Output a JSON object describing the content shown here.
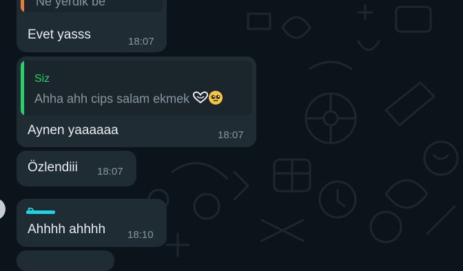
{
  "colors": {
    "background": "#0b141a",
    "bubble": "#1f2c34",
    "quote_bar_orange": "#e87e3a",
    "quote_bar_green": "#25d366",
    "quote_author_green": "#25d366",
    "sender_name": "#2dd4e6",
    "timestamp": "#8696a0"
  },
  "messages": [
    {
      "quote": {
        "text": "Ne yerdik be"
      },
      "text": "Evet yasss",
      "time": "18:07"
    },
    {
      "quote": {
        "author": "Siz",
        "text": "Ahha ahh cips salam ekmek",
        "emojis": [
          "hand-heart-icon",
          "pleading-face-icon"
        ]
      },
      "text": "Aynen yaaaaaa",
      "time": "18:07"
    },
    {
      "text": "Özlendiii",
      "time": "18:07"
    },
    {
      "sender": "D",
      "text": "Ahhhh ahhhh",
      "time": "18:10"
    }
  ]
}
